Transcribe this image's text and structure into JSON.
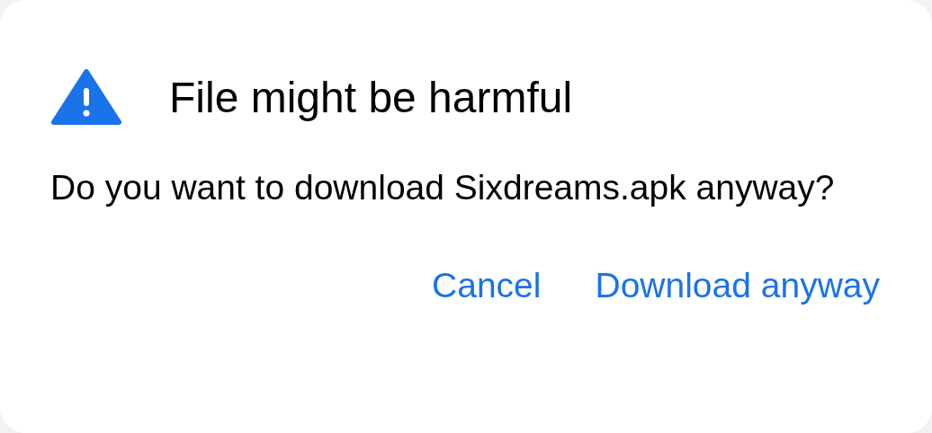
{
  "dialog": {
    "title": "File might be harmful",
    "message": "Do you want to download Sixdreams.apk anyway?",
    "buttons": [
      "Cancel",
      "Download anyway"
    ]
  }
}
